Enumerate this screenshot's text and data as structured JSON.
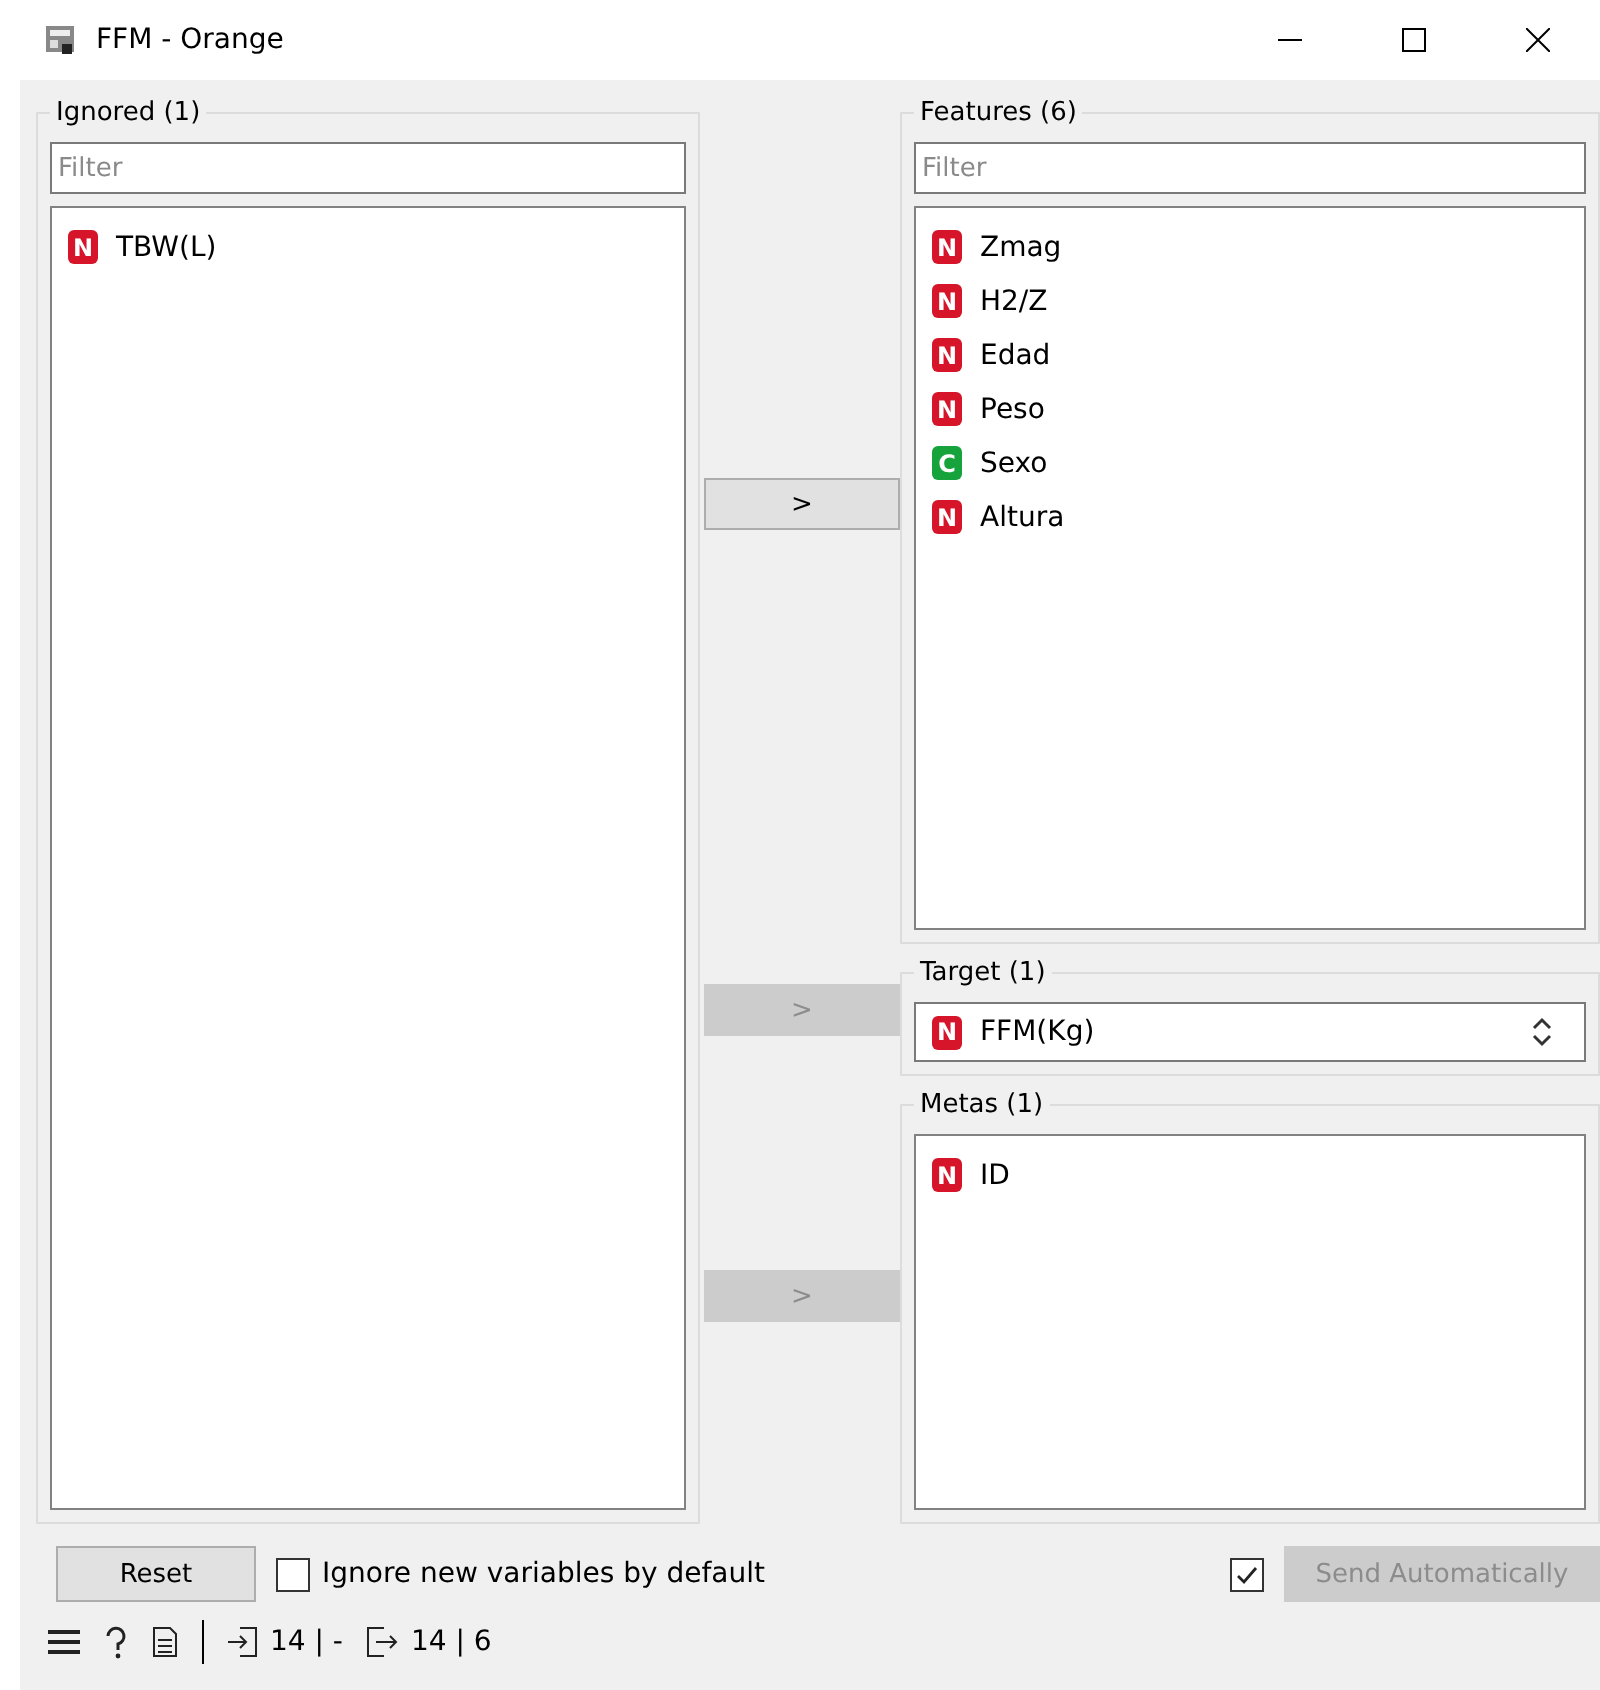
{
  "window": {
    "title": "FFM - Orange"
  },
  "ignored": {
    "title": "Ignored (1)",
    "filter_placeholder": "Filter",
    "items": [
      {
        "kind": "numeric",
        "badge": "N",
        "name": "TBW(L)"
      }
    ]
  },
  "features": {
    "title": "Features (6)",
    "filter_placeholder": "Filter",
    "items": [
      {
        "kind": "numeric",
        "badge": "N",
        "name": "Zmag"
      },
      {
        "kind": "numeric",
        "badge": "N",
        "name": "H2/Z"
      },
      {
        "kind": "numeric",
        "badge": "N",
        "name": "Edad"
      },
      {
        "kind": "numeric",
        "badge": "N",
        "name": "Peso"
      },
      {
        "kind": "categorical",
        "badge": "C",
        "name": "Sexo"
      },
      {
        "kind": "numeric",
        "badge": "N",
        "name": "Altura"
      }
    ]
  },
  "move_buttons": [
    {
      "label": ">",
      "disabled": false
    },
    {
      "label": ">",
      "disabled": true
    },
    {
      "label": ">",
      "disabled": true
    }
  ],
  "target": {
    "title": "Target (1)",
    "value": {
      "kind": "numeric",
      "badge": "N",
      "name": "FFM(Kg)"
    }
  },
  "metas": {
    "title": "Metas (1)",
    "items": [
      {
        "kind": "numeric",
        "badge": "N",
        "name": "ID"
      }
    ]
  },
  "reset_button": "Reset",
  "ignore_new": {
    "label": "Ignore new variables by default",
    "checked": false
  },
  "send": {
    "label": "Send Automatically",
    "checked": true,
    "disabled": true
  },
  "status_bar": {
    "input": "14 | -",
    "output": "14 | 6"
  }
}
